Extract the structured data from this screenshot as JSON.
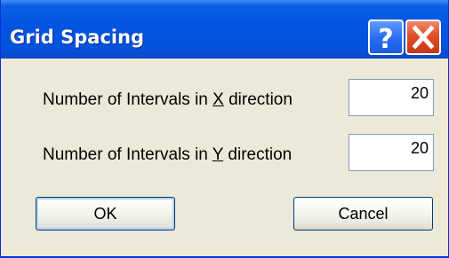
{
  "window": {
    "title": "Grid Spacing",
    "help_icon": "help-question-icon",
    "close_icon": "close-x-icon"
  },
  "form": {
    "x_label_prefix": "Number of Intervals in ",
    "x_label_key": "X",
    "x_label_suffix": " direction",
    "x_value": "20",
    "y_label_prefix": "Number of Intervals in ",
    "y_label_key": "Y",
    "y_label_suffix": " direction",
    "y_value": "20"
  },
  "buttons": {
    "ok_label": "OK",
    "cancel_label": "Cancel"
  },
  "colors": {
    "titlebar": "#0454e3",
    "dialog_face": "#ece9d8",
    "close_button": "#e0502a"
  }
}
